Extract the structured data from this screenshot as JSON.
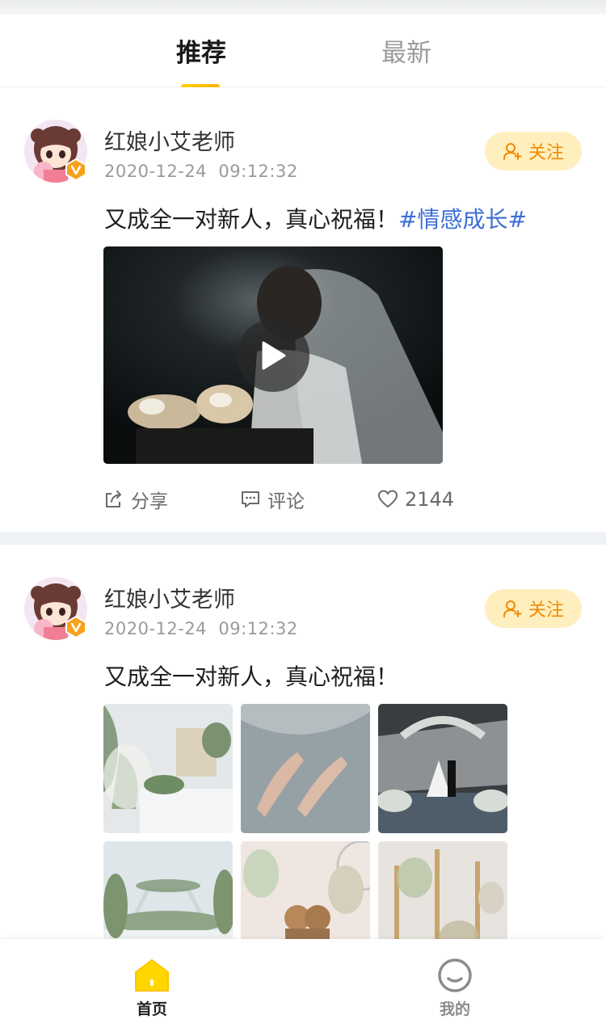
{
  "tabs": [
    {
      "label": "推荐",
      "active": true
    },
    {
      "label": "最新",
      "active": false
    }
  ],
  "colors": {
    "accent": "#ffc400",
    "follow_bg": "#ffefbf",
    "follow_text": "#f08a00",
    "hashtag": "#3d6fd6",
    "divider": "#eff2f5"
  },
  "posts": [
    {
      "author": "红娘小艾老师",
      "date": "2020-12-24  09:12:32",
      "follow_label": "关注",
      "text": "又成全一对新人，真心祝福！",
      "hashtag": "#情感成长#",
      "media": "video",
      "actions": {
        "share": "分享",
        "comment": "评论",
        "likes": "2144"
      }
    },
    {
      "author": "红娘小艾老师",
      "date": "2020-12-24  09:12:32",
      "follow_label": "关注",
      "text": "又成全一对新人，真心祝福！",
      "media": "image-grid",
      "images": [
        "wedding-table-flowers",
        "bridal-shoes",
        "couple-on-stage",
        "flower-arch",
        "teddy-bears",
        "gold-arches"
      ]
    }
  ],
  "bottom_nav": [
    {
      "label": "首页",
      "icon": "home-icon",
      "active": true
    },
    {
      "label": "我的",
      "icon": "smile-profile-icon",
      "active": false
    }
  ]
}
